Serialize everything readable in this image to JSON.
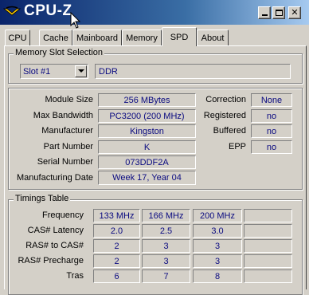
{
  "window": {
    "title": "CPU-Z"
  },
  "tabs": [
    "CPU",
    "Cache",
    "Mainboard",
    "Memory",
    "SPD",
    "About"
  ],
  "active_tab": "SPD",
  "slot_section": {
    "label": "Memory Slot Selection",
    "selected_slot": "Slot #1",
    "memory_type": "DDR"
  },
  "module": {
    "size_label": "Module Size",
    "size": "256 MBytes",
    "bandwidth_label": "Max Bandwidth",
    "bandwidth": "PC3200 (200 MHz)",
    "manufacturer_label": "Manufacturer",
    "manufacturer": "Kingston",
    "part_label": "Part Number",
    "part": "K",
    "serial_label": "Serial Number",
    "serial": "073DDF2A",
    "date_label": "Manufacturing Date",
    "date": "Week 17, Year 04",
    "correction_label": "Correction",
    "correction": "None",
    "registered_label": "Registered",
    "registered": "no",
    "buffered_label": "Buffered",
    "buffered": "no",
    "epp_label": "EPP",
    "epp": "no"
  },
  "timings": {
    "label": "Timings Table",
    "rows": [
      {
        "label": "Frequency",
        "values": [
          "133 MHz",
          "166 MHz",
          "200 MHz",
          ""
        ]
      },
      {
        "label": "CAS# Latency",
        "values": [
          "2.0",
          "2.5",
          "3.0",
          ""
        ]
      },
      {
        "label": "RAS# to CAS#",
        "values": [
          "2",
          "3",
          "3",
          ""
        ]
      },
      {
        "label": "RAS# Precharge",
        "values": [
          "2",
          "3",
          "3",
          ""
        ]
      },
      {
        "label": "Tras",
        "values": [
          "6",
          "7",
          "8",
          ""
        ]
      }
    ]
  }
}
